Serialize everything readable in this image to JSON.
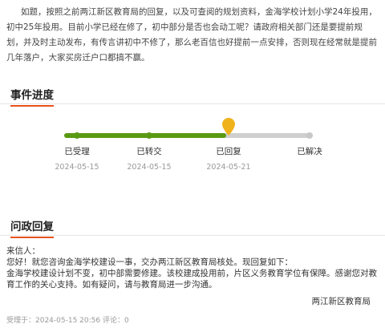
{
  "question": {
    "text": "如题，按照之前两江新区教育局的回复，以及可查阅的规划资料，金海学校计划小学24年投用，初中25年投用。目前小学已经在修了，初中部分是否也会动工呢？请政府相关部门还是要提前规划，并及时主动发布，有传言讲初中不修了，那么老百信也好提前一点安排，否则现在经常就是提前几年落户，大家买房迁户口都搞不赢。"
  },
  "progress": {
    "title": "事件进度",
    "fill_fraction": 0.66,
    "steps": [
      {
        "label": "已受理",
        "date": "2024-05-15",
        "state": "done"
      },
      {
        "label": "已转交",
        "date": "2024-05-15",
        "state": "done"
      },
      {
        "label": "已回复",
        "date": "2024-05-21",
        "state": "current"
      },
      {
        "label": "已解决",
        "date": "",
        "state": "pending"
      }
    ]
  },
  "reply": {
    "title": "问政回复",
    "greeting": "来信人：",
    "line1": "您好！就您咨询金海学校建设一事，交办两江新区教育局核处。现回复如下：",
    "line2": "金海学校建设计划不变，初中部需要修建。该校建成投用前，片区义务教育学位有保障。感谢您对教育工作的关心支持。如有疑问，请与教育局进一步沟通。",
    "signature": "两江新区教育局"
  },
  "meta": {
    "text": "受理于：2024-05-15 20:56 评论：0"
  },
  "colors": {
    "accent": "#e8531d",
    "progress_green": "#5a9a12",
    "pin_yellow": "#f0b21c",
    "track_gray": "#cfcfcf"
  },
  "icons": {
    "current_step": "map-pin-icon"
  }
}
